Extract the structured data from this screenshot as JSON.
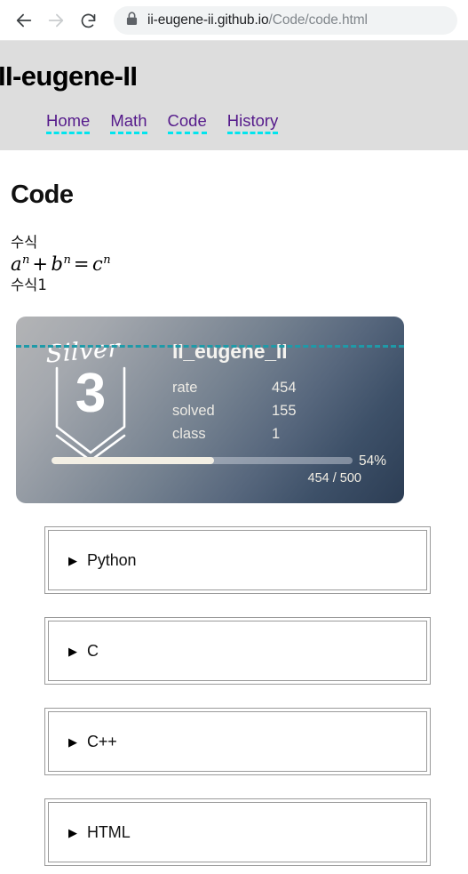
{
  "browser": {
    "back_icon": "back-arrow-icon",
    "forward_icon": "forward-arrow-icon",
    "reload_icon": "reload-icon",
    "lock_icon": "lock-icon",
    "url_domain": "ii-eugene-ii.github.io",
    "url_path": "/Code/code.html"
  },
  "header": {
    "site_title": "II-eugene-II",
    "nav": [
      {
        "label": "Home"
      },
      {
        "label": "Math"
      },
      {
        "label": "Code"
      },
      {
        "label": "History"
      }
    ],
    "background": "#dddddd",
    "link_color": "#551a8b",
    "underline_color": "#00e5ee"
  },
  "main": {
    "page_title": "Code",
    "math": {
      "label_top": "수식",
      "formula_plain": "a^n + b^n = c^n",
      "formula_parts": {
        "a": "a",
        "a_sup": "n",
        "plus": "+",
        "b": "b",
        "b_sup": "n",
        "equals": "=",
        "c": "c",
        "c_sup": "n"
      },
      "label_bottom": "수식1"
    },
    "badge": {
      "tier_name": "Silver",
      "tier_number": "3",
      "handle": "II_eugene_II",
      "stats": [
        {
          "label": "rate",
          "value": "454"
        },
        {
          "label": "solved",
          "value": "155"
        },
        {
          "label": "class",
          "value": "1"
        }
      ],
      "progress_percent_label": "54%",
      "progress_percent": 54,
      "progress_ratio": "454 / 500",
      "gradient_from": "#b3b4b6",
      "gradient_to": "#2c3d54",
      "fill_color": "#f3efe4",
      "underline_color": "#1f9aa8"
    },
    "details": [
      {
        "label": "Python",
        "marker": "▶"
      },
      {
        "label": "C",
        "marker": "▶"
      },
      {
        "label": "C++",
        "marker": "▶"
      },
      {
        "label": "HTML",
        "marker": "▶"
      }
    ]
  }
}
